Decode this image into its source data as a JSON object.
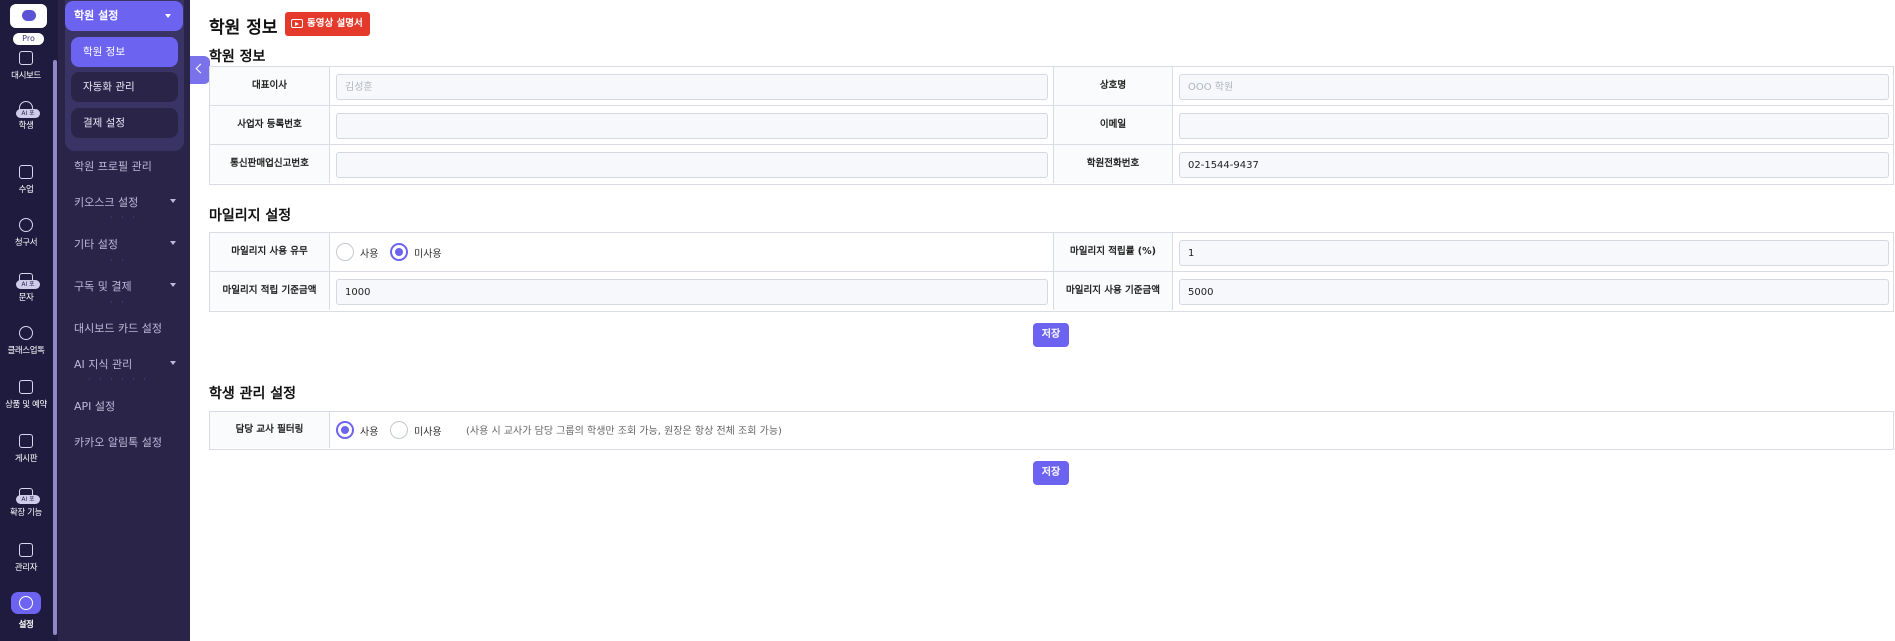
{
  "rail": {
    "pro_badge": "Pro",
    "items": [
      {
        "label": "대시보드",
        "icon": "dashboard-icon"
      },
      {
        "label": "학생",
        "icon": "students-icon",
        "badge": "AI 포"
      },
      {
        "label": "수업",
        "icon": "calendar-icon"
      },
      {
        "label": "청구서",
        "icon": "won-icon"
      },
      {
        "label": "문자",
        "icon": "message-icon",
        "badge": "AI 포"
      },
      {
        "label": "클래스업톡",
        "icon": "location-icon"
      },
      {
        "label": "상품 및 예약",
        "icon": "bag-icon"
      },
      {
        "label": "게시판",
        "icon": "chat-icon"
      },
      {
        "label": "확장 기능",
        "icon": "puzzle-icon",
        "badge": "AI 포"
      },
      {
        "label": "관리자",
        "icon": "admin-icon"
      },
      {
        "label": "설정",
        "icon": "gear-icon"
      }
    ]
  },
  "sub": {
    "group_title": "학원 설정",
    "group_items": [
      "학원 정보",
      "자동화 관리",
      "결제 설정"
    ],
    "items": [
      {
        "label": "학원 프로필 관리",
        "dropdown": false
      },
      {
        "label": "키오스크 설정",
        "dropdown": true
      },
      {
        "label": "기타 설정",
        "dropdown": true
      },
      {
        "label": "구독 및 결제",
        "dropdown": true
      },
      {
        "label": "대시보드 카드 설정",
        "dropdown": false
      },
      {
        "label": "AI 지식 관리",
        "dropdown": true
      },
      {
        "label": "API 설정",
        "dropdown": false
      },
      {
        "label": "카카오 알림톡 설정",
        "dropdown": false
      }
    ]
  },
  "page": {
    "title": "학원 정보",
    "video_button": "동영상 설명서"
  },
  "academy": {
    "title": "학원 정보",
    "rep_label": "대표이사",
    "rep_placeholder": "김성훈",
    "rep_value": "",
    "name_label": "상호명",
    "name_placeholder": "OOO 학원",
    "name_value": "",
    "biz_label": "사업자 등록번호",
    "biz_value": "",
    "email_label": "이메일",
    "email_value": "",
    "ecom_label": "통신판매업신고번호",
    "ecom_value": "",
    "phone_label": "학원전화번호",
    "phone_value": "02-1544-9437"
  },
  "mileage": {
    "title": "마일리지 설정",
    "use_label": "마일리지 사용 유무",
    "use_on": "사용",
    "use_off": "미사용",
    "use_selected": "미사용",
    "rate_label": "마일리지 적립률 (%)",
    "rate_value": "1",
    "earn_base_label": "마일리지 적립 기준금액",
    "earn_base_value": "1000",
    "use_base_label": "마일리지 사용 기준금액",
    "use_base_value": "5000",
    "save": "저장"
  },
  "student": {
    "title": "학생 관리 설정",
    "filter_label": "담당 교사 필터링",
    "on": "사용",
    "off": "미사용",
    "selected": "사용",
    "hint": "(사용 시 교사가 담당 그룹의 학생만 조회 가능, 원장은 항상 전체 조회 가능)",
    "save": "저장"
  },
  "colors": {
    "accent": "#6c63f0",
    "video_button": "#e33a2c",
    "rail": "#1f1b3f"
  }
}
